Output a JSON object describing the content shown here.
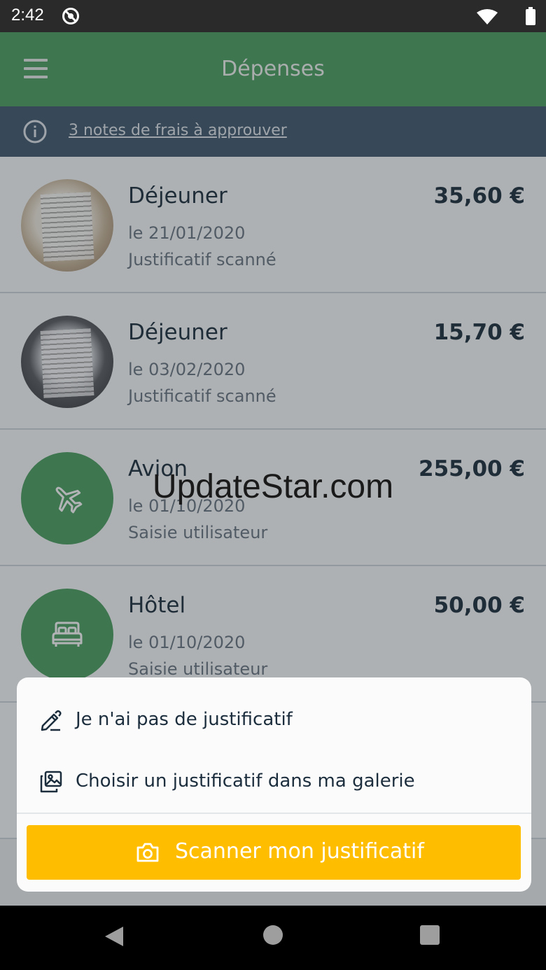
{
  "status_bar": {
    "time": "2:42"
  },
  "toolbar": {
    "title": "Dépenses"
  },
  "banner": {
    "link_text": "3 notes de frais à approuver"
  },
  "expenses": [
    {
      "title": "Déjeuner",
      "date": "le 21/01/2020",
      "source": "Justificatif scanné",
      "amount": "35,60 €",
      "thumb": "receipt-photo"
    },
    {
      "title": "Déjeuner",
      "date": "le 03/02/2020",
      "source": "Justificatif scanné",
      "amount": "15,70 €",
      "thumb": "receipt-photo"
    },
    {
      "title": "Avion",
      "date": "le 01/10/2020",
      "source": "Saisie utilisateur",
      "amount": "255,00 €",
      "thumb": "airplane-icon"
    },
    {
      "title": "Hôtel",
      "date": "le 01/10/2020",
      "source": "Saisie utilisateur",
      "amount": "50,00 €",
      "thumb": "bed-icon"
    }
  ],
  "watermark": "UpdateStar.com",
  "sheet": {
    "no_receipt_label": "Je n'ai pas de justificatif",
    "gallery_label": "Choisir un justificatif dans ma galerie",
    "scan_label": "Scanner mon justificatif"
  },
  "colors": {
    "primary_green": "#4ba062",
    "banner": "#415a6e",
    "scan_button": "#ffbd00",
    "text_dark": "#1c2e3d"
  }
}
